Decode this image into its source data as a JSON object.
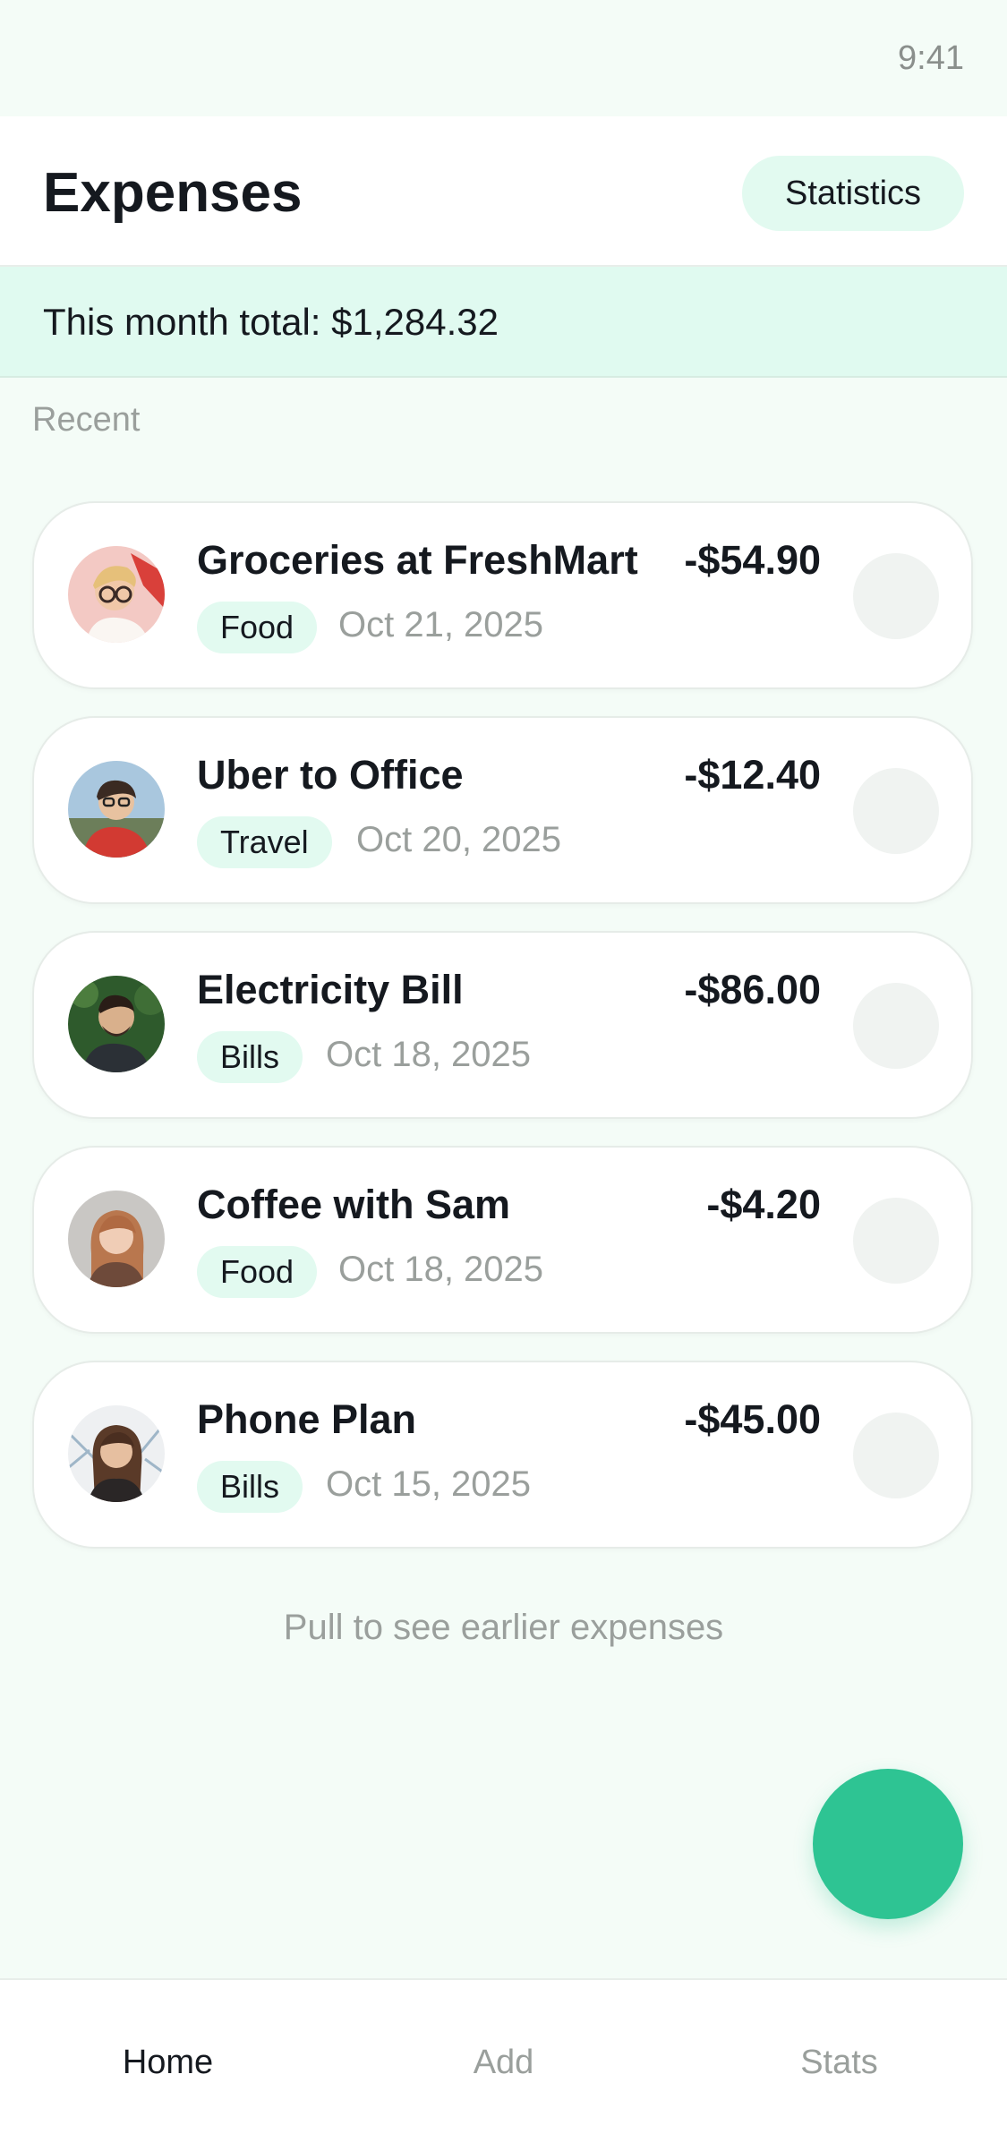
{
  "status_bar": {
    "time": "9:41"
  },
  "header": {
    "title": "Expenses",
    "stats_button": "Statistics"
  },
  "summary": {
    "total_text": "This month total: $1,284.32"
  },
  "list": {
    "section_label": "Recent",
    "items": [
      {
        "title": "Groceries at FreshMart",
        "amount": "-$54.90",
        "category": "Food",
        "date": "Oct 21, 2025"
      },
      {
        "title": "Uber to Office",
        "amount": "-$12.40",
        "category": "Travel",
        "date": "Oct 20, 2025"
      },
      {
        "title": "Electricity Bill",
        "amount": "-$86.00",
        "category": "Bills",
        "date": "Oct 18, 2025"
      },
      {
        "title": "Coffee with Sam",
        "amount": "-$4.20",
        "category": "Food",
        "date": "Oct 18, 2025"
      },
      {
        "title": "Phone Plan",
        "amount": "-$45.00",
        "category": "Bills",
        "date": "Oct 15, 2025"
      }
    ],
    "footer_hint": "Pull to see earlier expenses"
  },
  "nav": {
    "items": [
      {
        "label": "Home",
        "active": true
      },
      {
        "label": "Add"
      },
      {
        "label": "Stats"
      }
    ]
  },
  "colors": {
    "accent": "#2ec493",
    "chip_bg": "#e2faf0",
    "page_bg": "#f4fcf7",
    "banner_bg": "#e0faf0",
    "muted_text": "#9a9f9c"
  }
}
